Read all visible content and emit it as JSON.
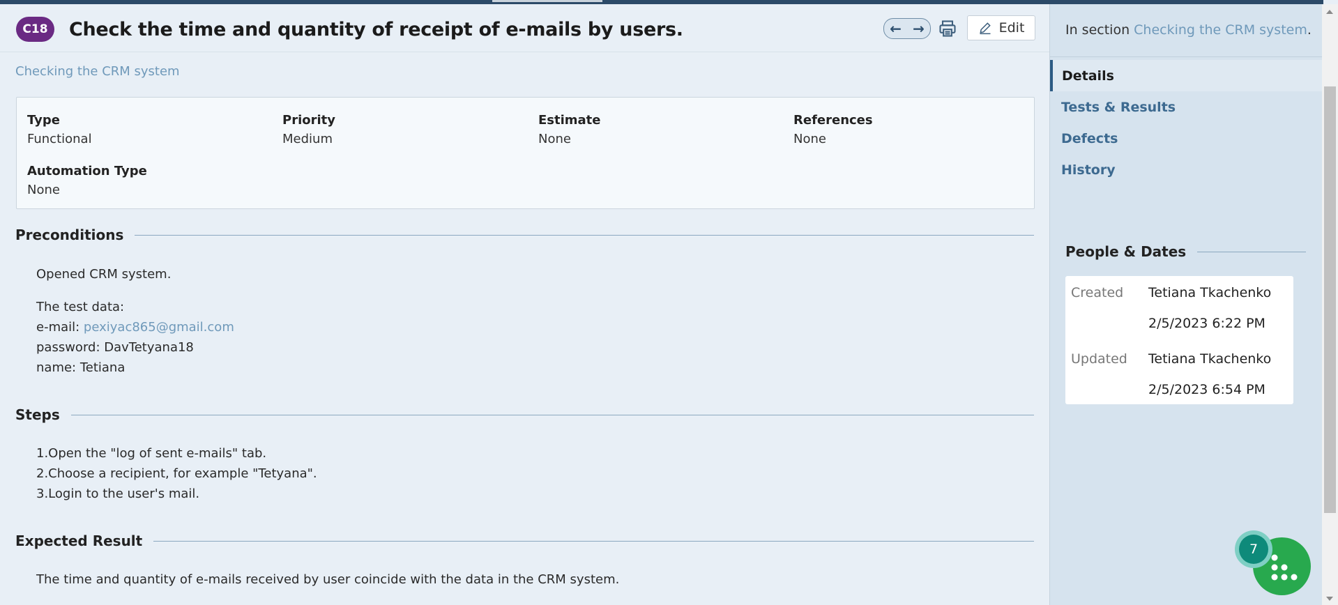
{
  "header": {
    "case_id": "C18",
    "title": "Check the time and quantity of receipt of e-mails by users.",
    "edit_label": "Edit"
  },
  "breadcrumb_section": "Checking the CRM system",
  "fields": [
    {
      "label": "Type",
      "value": "Functional"
    },
    {
      "label": "Priority",
      "value": "Medium"
    },
    {
      "label": "Estimate",
      "value": "None"
    },
    {
      "label": "References",
      "value": "None"
    },
    {
      "label": "Automation Type",
      "value": "None"
    }
  ],
  "preconditions": {
    "heading": "Preconditions",
    "line1": "Opened CRM system.",
    "line2": "The test data:",
    "email_label": "e-mail: ",
    "email_value": "pexiyac865@gmail.com",
    "password_line": "password: DavTetyana18",
    "name_line": "name: Tetiana"
  },
  "steps": {
    "heading": "Steps",
    "items": [
      "1.Open the \"log of sent e-mails\" tab.",
      "2.Choose a recipient, for example \"Tetyana\".",
      "3.Login to the user's mail."
    ]
  },
  "expected": {
    "heading": "Expected Result",
    "text": "The time and quantity of e-mails received by user coincide with the data in the CRM system."
  },
  "sidebar": {
    "in_section_prefix": "In section ",
    "in_section_link": "Checking the CRM system",
    "in_section_suffix": ".",
    "nav": [
      "Details",
      "Tests & Results",
      "Defects",
      "History"
    ],
    "active_nav": "Details",
    "people_dates_heading": "People & Dates",
    "created_label": "Created",
    "created_by": "Tetiana Tkachenko",
    "created_at": "2/5/2023 6:22 PM",
    "updated_label": "Updated",
    "updated_by": "Tetiana Tkachenko",
    "updated_at": "2/5/2023 6:54 PM"
  },
  "fab": {
    "badge_count": "7"
  },
  "icons": [
    "arrow-left-icon",
    "arrow-right-icon",
    "printer-icon",
    "pencil-icon",
    "grid-icon"
  ],
  "colors": {
    "badge": "#6a2a83",
    "link": "#6f99ba",
    "nav": "#3d6a90",
    "fab": "#28a94e",
    "fab_badge": "#0e8a7a"
  }
}
